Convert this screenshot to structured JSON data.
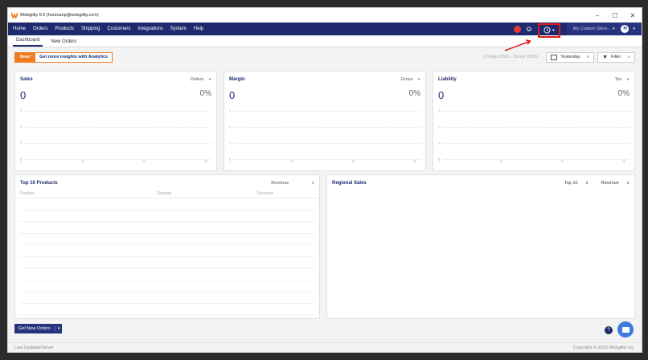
{
  "window": {
    "title": "Webgility 9.5 (hoomanp@webgility.com)",
    "controls": [
      "–",
      "☐",
      "✕"
    ]
  },
  "menu": {
    "items": [
      "Home",
      "Orders",
      "Products",
      "Shipping",
      "Customers",
      "Integrations",
      "System",
      "Help"
    ],
    "store_label": "My Custom Store...",
    "avatar_initial": "H"
  },
  "tabs": [
    "Dashboard",
    "New Orders"
  ],
  "toolbar": {
    "promo_badge": "New!",
    "promo_text": "Get more insights with Analytics",
    "date_range": "(19 Apr 2023 - 19 Apr 2023)",
    "period": "Yesterday",
    "filter_label": "Filter"
  },
  "cards": {
    "sales": {
      "title": "Sales",
      "selector": "Orders",
      "value": "0",
      "pct": "0%"
    },
    "margin": {
      "title": "Margin",
      "selector": "Gross",
      "value": "0",
      "pct": "0%"
    },
    "liability": {
      "title": "Liability",
      "selector": "Tax",
      "value": "0",
      "pct": "0%"
    }
  },
  "mini_chart": {
    "y_ticks": [
      "3",
      "2",
      "1",
      "0"
    ],
    "x_ticks": [
      "1",
      "11",
      "21",
      "28"
    ]
  },
  "top_products": {
    "title": "Top 10 Products",
    "selector": "Revenue",
    "columns": [
      "Product",
      "Quantity",
      "Revenue"
    ]
  },
  "regional": {
    "title": "Regional Sales",
    "top_selector": "Top 10",
    "metric_selector": "Revenue"
  },
  "footer": {
    "button": "Get New Orders",
    "last_updated": "Last Updated:Never",
    "copyright": "Copyright © 2023 Webgility Inc."
  },
  "colors": {
    "navy": "#1f2a6e",
    "orange": "#f07c20",
    "highlight": "#e01b1b"
  }
}
